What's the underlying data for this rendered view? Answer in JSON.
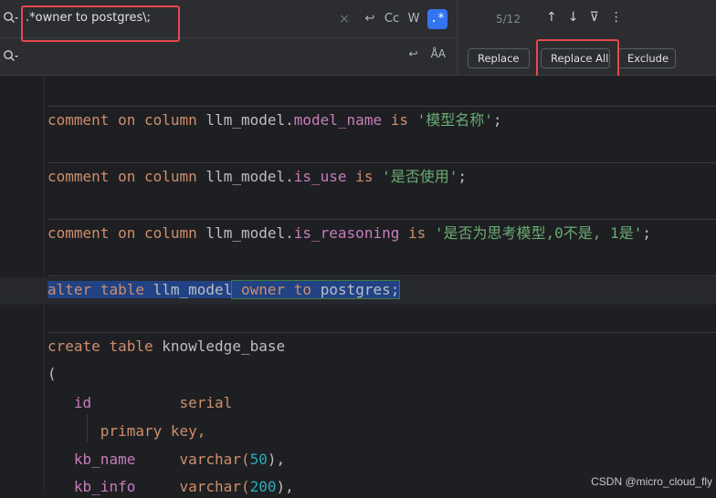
{
  "find": {
    "query": ".*owner to postgres\\;",
    "clear_glyph": "×",
    "newline_glyph": "↩",
    "case_label": "Cc",
    "words_label": "W",
    "regex_label": ".*"
  },
  "replace": {
    "value": "",
    "preserve_case_glyph": "ÅA",
    "newline_glyph": "↩"
  },
  "results": {
    "match_count": "5/12",
    "prev_glyph": "↑",
    "next_glyph": "↓",
    "filter_glyph": "⊽",
    "more_glyph": "⋮"
  },
  "buttons": {
    "replace_label": "Replace",
    "replace_all_label": "Replace All",
    "exclude_label": "Exclude"
  },
  "code": {
    "l1": {
      "a": "comment",
      "b": "on",
      "c": "column",
      "d": "llm_model.",
      "e": "model_name",
      "f": "is",
      "g": "'模型名称'",
      "h": ";"
    },
    "l2": {
      "a": "comment",
      "b": "on",
      "c": "column",
      "d": "llm_model.",
      "e": "is_use",
      "f": "is",
      "g": "'是否使用'",
      "h": ";"
    },
    "l3": {
      "a": "comment",
      "b": "on",
      "c": "column",
      "d": "llm_model.",
      "e": "is_reasoning",
      "f": "is",
      "g": "'是否为思考模型,0不是, 1是'",
      "h": ";"
    },
    "l4": {
      "a": "alter",
      "b": "table",
      "c": "llm_model",
      "d": "owner",
      "e": "to",
      "f": "postgres;"
    },
    "l5": {
      "a": "create",
      "b": "table",
      "c": "knowledge_base"
    },
    "l6": {
      "a": "("
    },
    "l7": {
      "a": "id",
      "b": "serial"
    },
    "l8": {
      "a": "primary",
      "b": "key,"
    },
    "l9": {
      "a": "kb_name",
      "b": "varchar(",
      "c": "50",
      "d": "),"
    },
    "l10": {
      "a": "kb_info",
      "b": "varchar(",
      "c": "200",
      "d": "),"
    }
  },
  "watermark": "CSDN @micro_cloud_fly",
  "colors": {
    "keyword": "#cf8e6d",
    "field": "#c77dbb",
    "string": "#6aab73",
    "number": "#2aacb8",
    "selection": "#214283",
    "annotation_box": "#e5484d",
    "regex_toggle": "#3574f0"
  }
}
